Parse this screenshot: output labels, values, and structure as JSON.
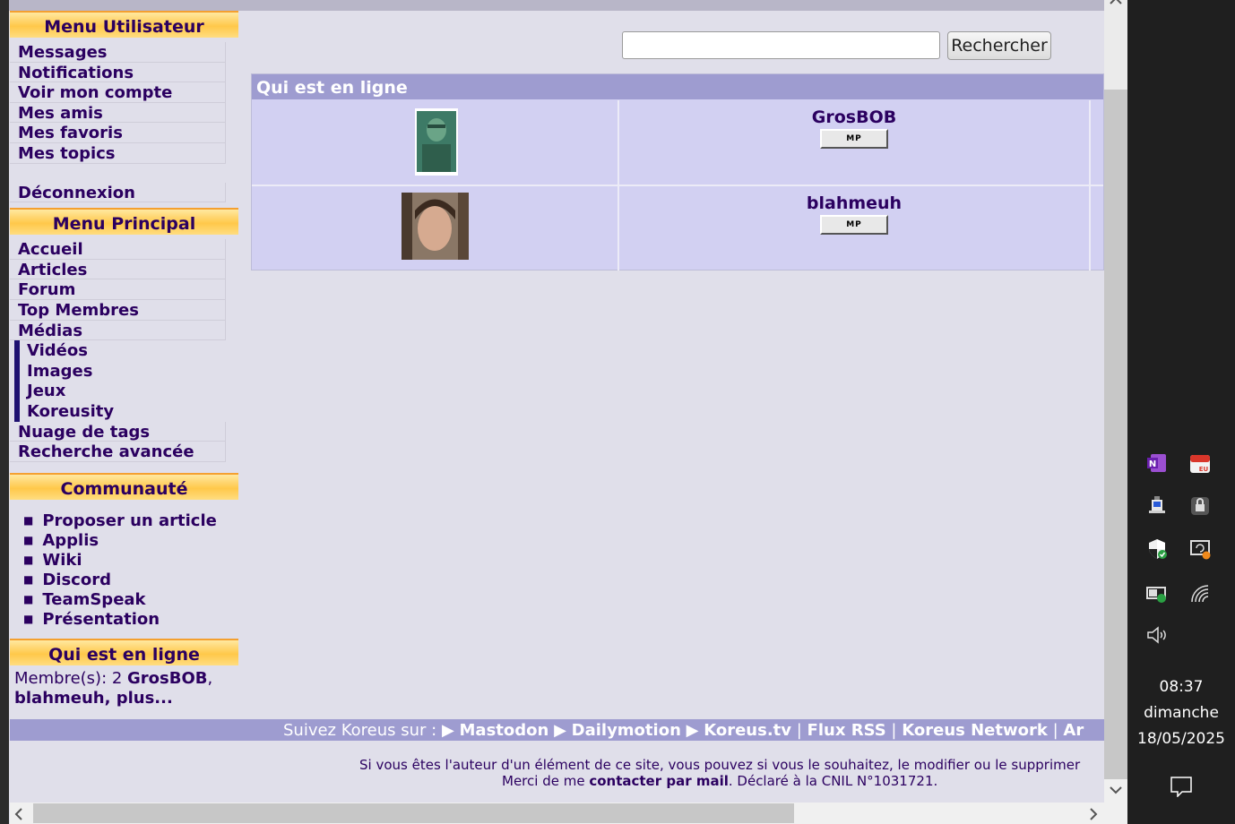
{
  "sidebar": {
    "user_menu": {
      "title": "Menu Utilisateur",
      "items": [
        "Messages",
        "Notifications",
        "Voir mon compte",
        "Mes amis",
        "Mes favoris",
        "Mes topics"
      ],
      "logout": "Déconnexion"
    },
    "main_menu": {
      "title": "Menu Principal",
      "items": [
        "Accueil",
        "Articles",
        "Forum",
        "Top Membres",
        "Médias"
      ],
      "media_sub": [
        "Vidéos",
        "Images",
        "Jeux",
        "Koreusity"
      ],
      "after": [
        "Nuage de tags",
        "Recherche avancée"
      ]
    },
    "community": {
      "title": "Communauté",
      "items": [
        "Proposer un article",
        "Applis",
        "Wiki",
        "Discord",
        "TeamSpeak",
        "Présentation"
      ]
    },
    "online": {
      "title": "Qui est en ligne",
      "prefix": "Membre(s): 2 ",
      "name1": "GrosBOB",
      "sep": ",",
      "name2": "blahmeuh, plus..."
    }
  },
  "search": {
    "value": "",
    "button_label": "Rechercher"
  },
  "online_table": {
    "title": "Qui est en ligne",
    "users": [
      {
        "name": "GrosBOB",
        "button": "MP"
      },
      {
        "name": "blahmeuh",
        "button": "MP"
      }
    ]
  },
  "footer": {
    "follow_prefix": "Suivez Koreus sur : ",
    "links": [
      "Mastodon",
      "Dailymotion",
      "Koreus.tv",
      "Flux RSS",
      "Koreus Network",
      "Ar"
    ],
    "legal_line1": "Si vous êtes l'auteur d'un élément de ce site, vous pouvez si vous le souhaitez, le modifier ou le supprimer",
    "legal_line2_pre": "Merci de me ",
    "legal_line2_link": "contacter par mail",
    "legal_line2_post": ". Déclaré à la CNIL N°1031721."
  },
  "taskbar": {
    "time": "08:37",
    "day": "dimanche",
    "date": "18/05/2025"
  }
}
